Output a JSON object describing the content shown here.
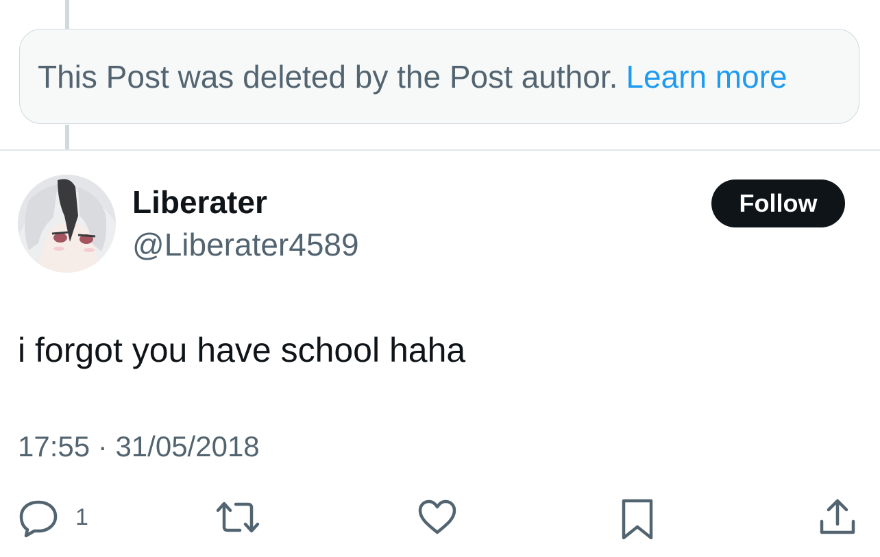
{
  "deleted_notice": {
    "text": "This Post was deleted by the Post author.",
    "link_label": "Learn more"
  },
  "author": {
    "display_name": "Liberater",
    "handle": "@Liberater4589",
    "avatar": "anime-avatar"
  },
  "follow_label": "Follow",
  "post": {
    "text": "i forgot you have school haha",
    "time": "17:55",
    "separator": "·",
    "date": "31/05/2018"
  },
  "actions": {
    "reply_count": "1",
    "icons": [
      "reply-icon",
      "repost-icon",
      "like-icon",
      "bookmark-icon",
      "share-icon"
    ]
  },
  "colors": {
    "link": "#1d9bf0",
    "muted": "#536471",
    "text": "#0f1419",
    "button_bg": "#0f1419",
    "notice_bg": "#f7f9f9",
    "border": "#cfd9de"
  }
}
